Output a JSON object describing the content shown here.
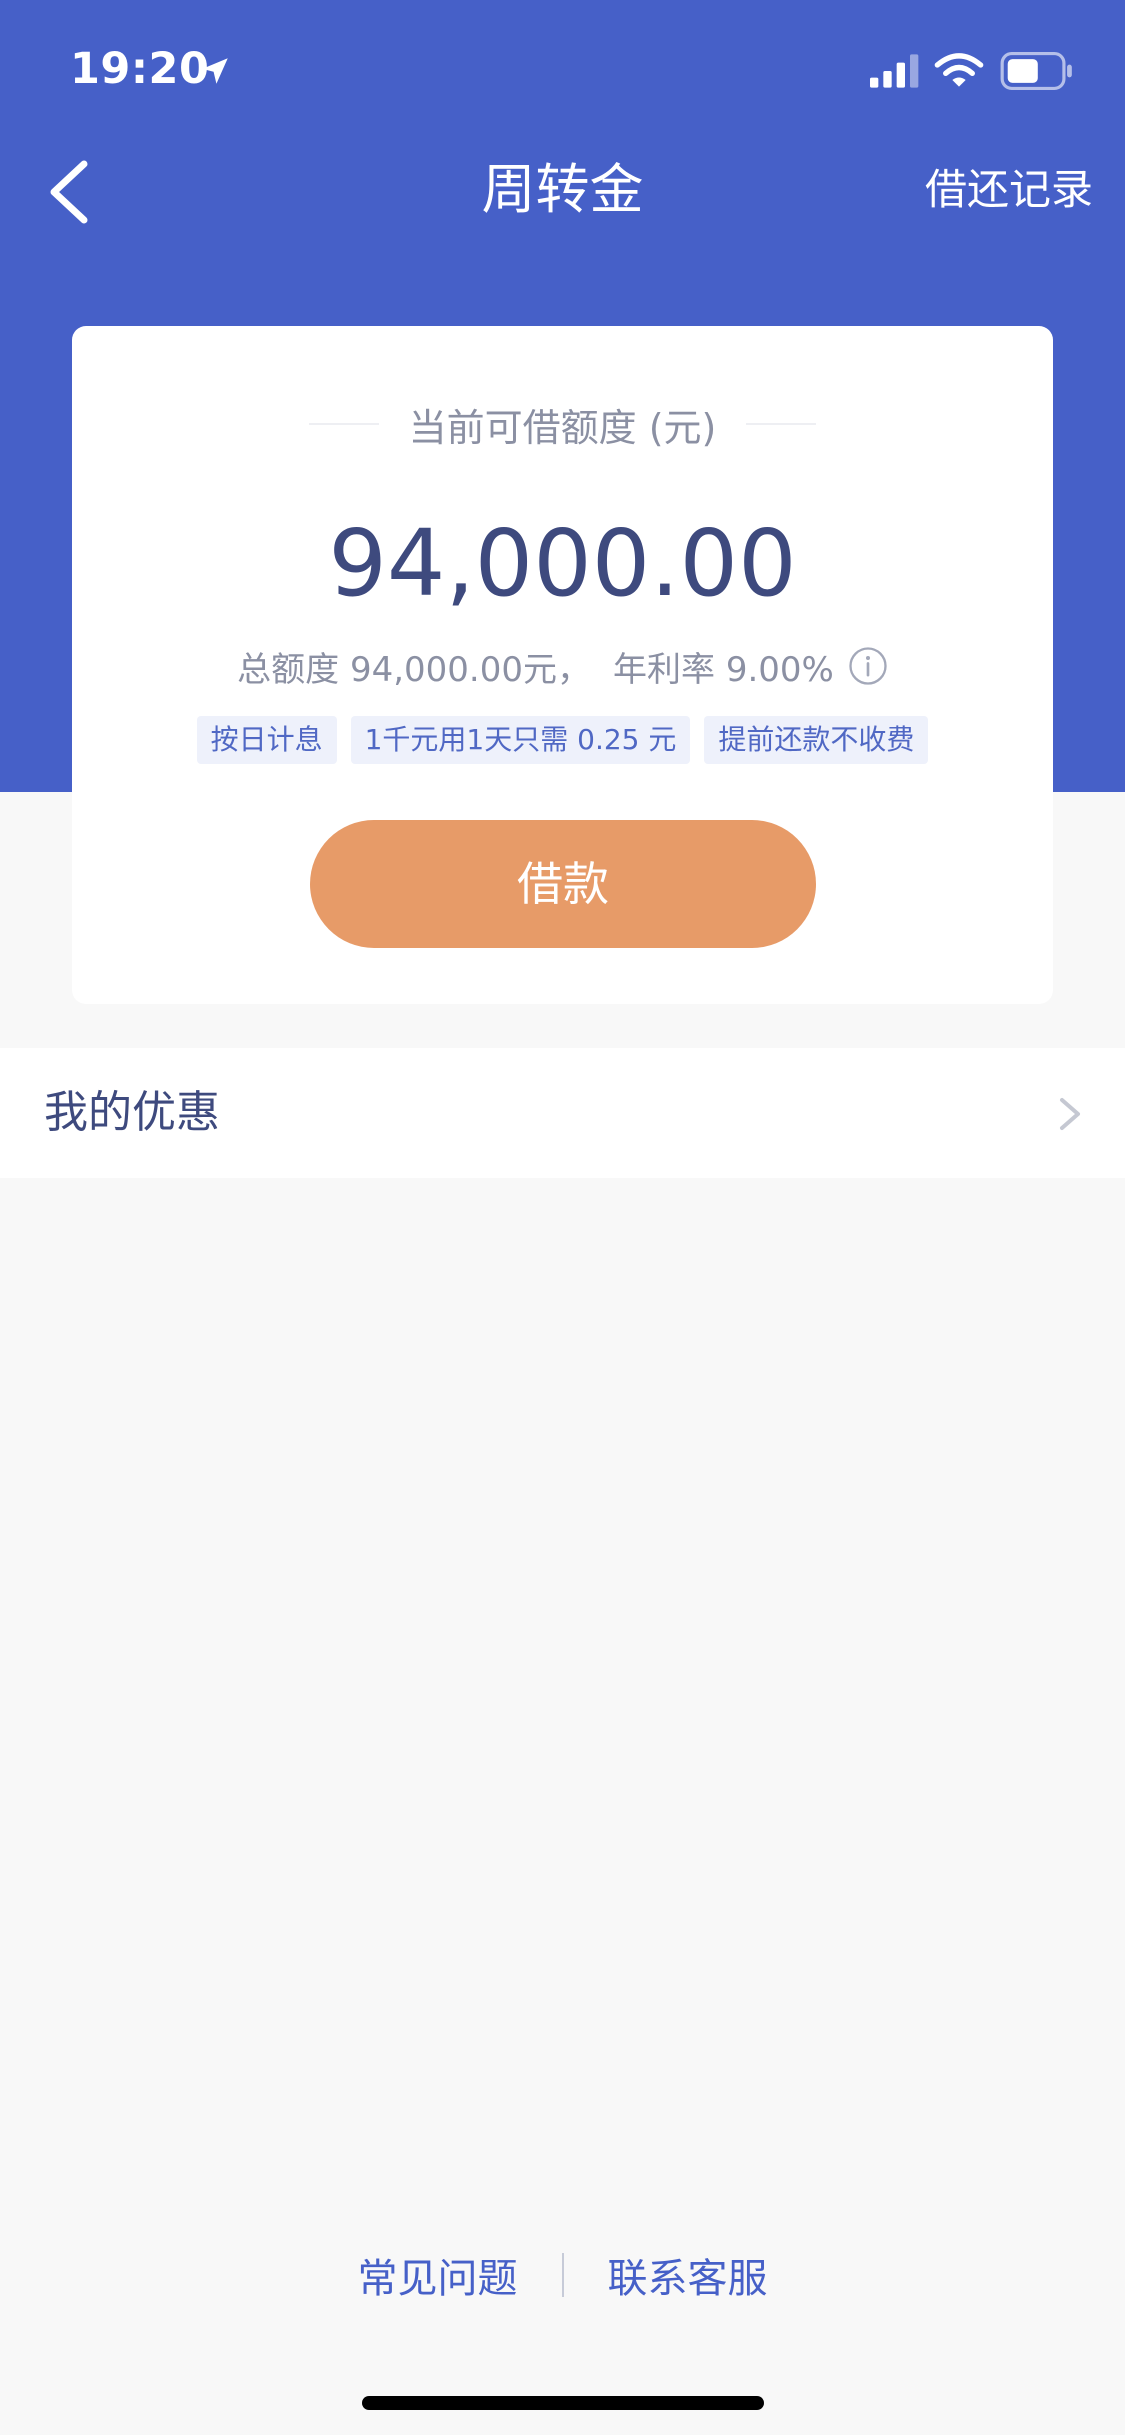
{
  "status_bar": {
    "time": "19:20",
    "icons": [
      "location-arrow-icon",
      "signal-icon",
      "wifi-icon",
      "battery-icon"
    ]
  },
  "nav": {
    "back_icon": "chevron-left-icon",
    "title": "周转金",
    "right_action": "借还记录"
  },
  "card": {
    "label": "当前可借额度 (元)",
    "amount": "94,000.00",
    "total_quota": "总额度 94,000.00元，",
    "annual_rate": "年利率 9.00%",
    "info_icon": "info-icon",
    "tags": [
      "按日计息",
      "1千元用1天只需 0.25 元",
      "提前还款不收费"
    ],
    "loan_button": "借款"
  },
  "offers": {
    "label": "我的优惠",
    "chevron_icon": "chevron-right-icon"
  },
  "footer": {
    "faq": "常见问题",
    "contact": "联系客服"
  },
  "colors": {
    "primary": "#4660c8",
    "button": "#e79b68",
    "amount_text": "#3e4a7e",
    "secondary_text": "#8b90a3",
    "tag_bg": "#eef1fb",
    "page_bg": "#f8f8f8"
  }
}
